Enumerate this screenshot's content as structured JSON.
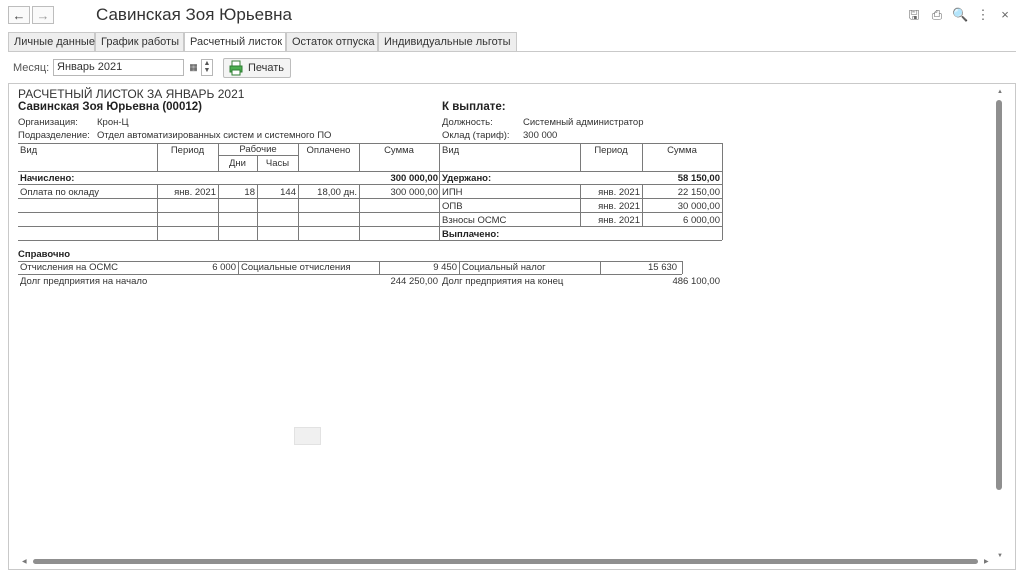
{
  "window": {
    "title": "Савинская Зоя Юрьевна",
    "back_icon": "←",
    "forward_icon": "→",
    "tools": [
      {
        "name": "save-icon",
        "glyph": "🖫"
      },
      {
        "name": "print-icon",
        "glyph": "⎙"
      },
      {
        "name": "preview-icon",
        "glyph": "🔍"
      },
      {
        "name": "more-icon",
        "glyph": "⋮"
      },
      {
        "name": "close-icon",
        "glyph": "×"
      }
    ]
  },
  "tabs": [
    "Личные данные",
    "График работы",
    "Расчетный листок",
    "Остаток отпуска",
    "Индивидуальные льготы"
  ],
  "active_tab": "Расчетный листок",
  "filter": {
    "month_label": "Месяц:",
    "month_value": "Январь 2021",
    "calendar_icon": "▦",
    "spin_up": "▲",
    "spin_down": "▼",
    "print_label": "Печать"
  },
  "sheet": {
    "heading": "РАСЧЕТНЫЙ ЛИСТОК ЗА ЯНВАРЬ 2021",
    "employee": "Савинская Зоя Юрьевна (00012)",
    "org_label": "Организация:",
    "org_value": "Крон-Ц",
    "dept_label": "Подразделение:",
    "dept_value": "Отдел автоматизированных систем и системного ПО",
    "to_pay_label": "К выплате:",
    "position_label": "Должность:",
    "position_value": "Системный администратор",
    "salary_label": "Оклад (тариф):",
    "salary_value": "300 000",
    "left_headers": {
      "kind": "Вид",
      "period": "Период",
      "work": "Рабочие",
      "days": "Дни",
      "hours": "Часы",
      "paid": "Оплачено",
      "sum": "Сумма"
    },
    "right_headers": {
      "kind": "Вид",
      "period": "Период",
      "sum": "Сумма"
    },
    "accrued_label": "Начислено:",
    "accrued_total": "300 000,00",
    "accruals": [
      {
        "kind": "Оплата по окладу",
        "period": "янв. 2021",
        "days": "18",
        "hours": "144",
        "paid": "18,00 дн.",
        "sum": "300 000,00"
      }
    ],
    "withheld_label": "Удержано:",
    "withheld_total": "58 150,00",
    "deductions": [
      {
        "kind": "ИПН",
        "period": "янв. 2021",
        "sum": "22 150,00"
      },
      {
        "kind": "ОПВ",
        "period": "янв. 2021",
        "sum": "30 000,00"
      },
      {
        "kind": "Взносы ОСМС",
        "period": "янв. 2021",
        "sum": "6 000,00"
      }
    ],
    "paid_out_label": "Выплачено:",
    "reference_label": "Справочно",
    "reference_row": [
      {
        "label": "Отчисления на ОСМС",
        "value": "6 000"
      },
      {
        "label": "Социальные отчисления",
        "value": "9 450"
      },
      {
        "label": "Социальный налог",
        "value": "15 630"
      }
    ],
    "debt_start_label": "Долг предприятия на начало",
    "debt_start_value": "244 250,00",
    "debt_end_label": "Долг предприятия на конец",
    "debt_end_value": "486 100,00"
  }
}
